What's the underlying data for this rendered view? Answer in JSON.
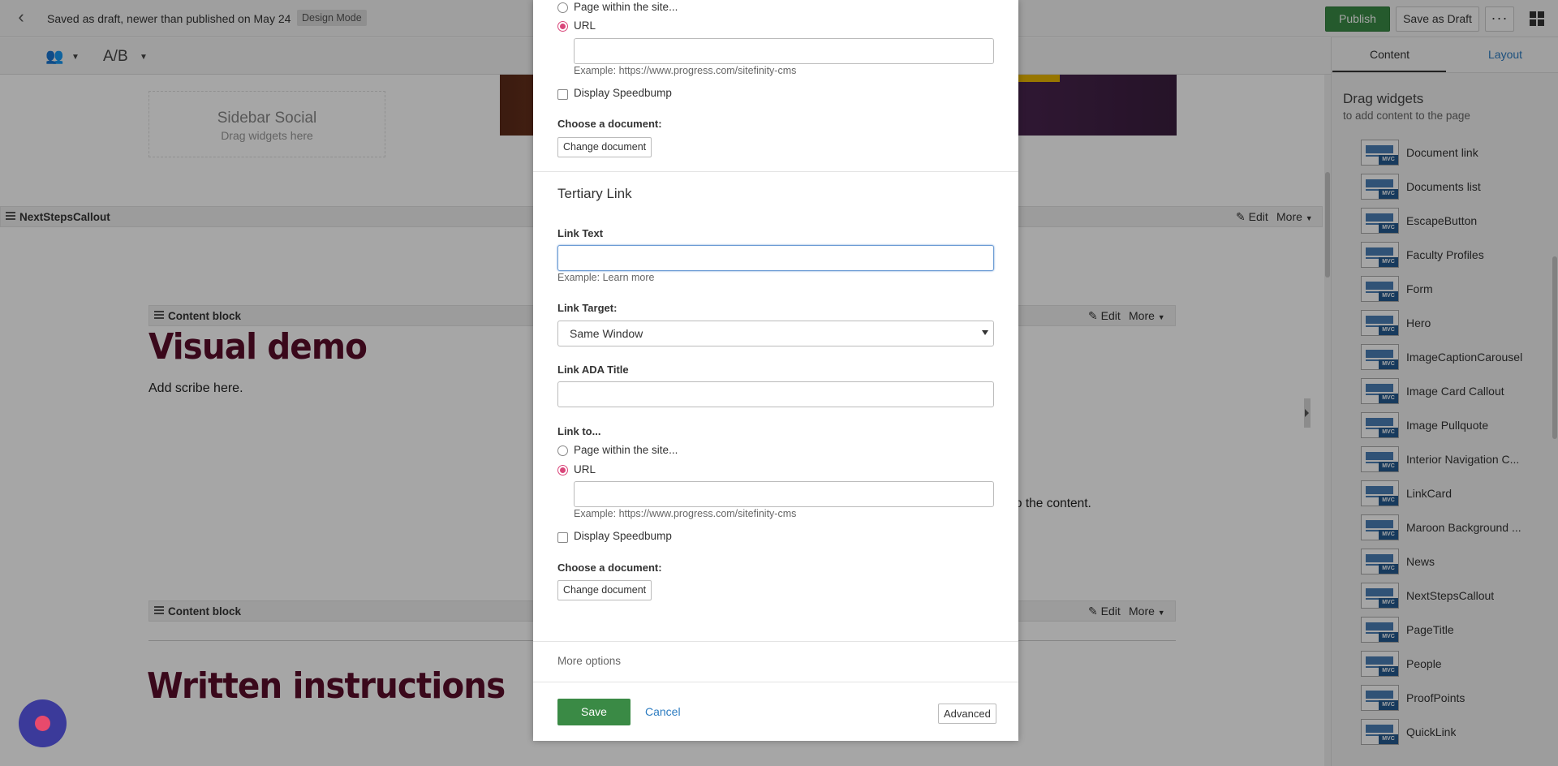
{
  "topbar": {
    "status_text": "Saved as draft, newer than published on May 24",
    "mode_badge": "Design Mode",
    "publish_label": "Publish",
    "save_draft_label": "Save as Draft",
    "more_label": "···"
  },
  "toolbar": {
    "ab_label": "A/B"
  },
  "canvas": {
    "sidebar_social_title": "Sidebar Social",
    "sidebar_social_hint": "Drag widgets here",
    "next_steps_bar": {
      "name": "NextStepsCallout",
      "edit": "Edit",
      "more": "More"
    },
    "content_block_1": {
      "name": "Content block",
      "edit": "Edit",
      "more": "More"
    },
    "visual_demo_title": "Visual demo",
    "scribe_text": "Add scribe here.",
    "content_tail": "t to the content.",
    "content_block_2": {
      "name": "Content block",
      "edit": "Edit",
      "more": "More"
    },
    "written_title": "Written instructions"
  },
  "right_panel": {
    "tabs": [
      {
        "label": "Content"
      },
      {
        "label": "Layout"
      }
    ],
    "heading": "Drag widgets",
    "subheading": "to add content to the page",
    "widgets": [
      "Document link",
      "Documents list",
      "EscapeButton",
      "Faculty Profiles",
      "Form",
      "Hero",
      "ImageCaptionCarousel",
      "Image Card Callout",
      "Image Pullquote",
      "Interior Navigation C...",
      "LinkCard",
      "Maroon Background ...",
      "News",
      "NextStepsCallout",
      "PageTitle",
      "People",
      "ProofPoints",
      "QuickLink"
    ],
    "mvc_badge": "MVC"
  },
  "modal": {
    "top": {
      "page_within_site": "Page within the site...",
      "url_option": "URL",
      "url_value": "",
      "url_hint": "Example: https://www.progress.com/sitefinity-cms",
      "display_speedbump": "Display Speedbump",
      "choose_document": "Choose a document:",
      "change_document": "Change document"
    },
    "tertiary": {
      "section_title": "Tertiary Link",
      "link_text_label": "Link Text",
      "link_text_value": "",
      "link_text_hint": "Example: Learn more",
      "link_target_label": "Link Target:",
      "link_target_value": "Same Window",
      "link_ada_title_label": "Link ADA Title",
      "link_ada_title_value": "",
      "link_to_label": "Link to...",
      "page_within_site": "Page within the site...",
      "url_option": "URL",
      "url_value": "",
      "url_hint": "Example: https://www.progress.com/sitefinity-cms",
      "display_speedbump": "Display Speedbump",
      "choose_document": "Choose a document:",
      "change_document": "Change document"
    },
    "more_options": "More options",
    "save_label": "Save",
    "cancel_label": "Cancel",
    "advanced_label": "Advanced"
  },
  "colors": {
    "publish_green": "#3a8a45",
    "title_maroon": "#5a0d2a",
    "link_blue": "#2d7cc1",
    "radio_selected": "#d9467a",
    "chat_bubble": "#3b3a9a"
  }
}
